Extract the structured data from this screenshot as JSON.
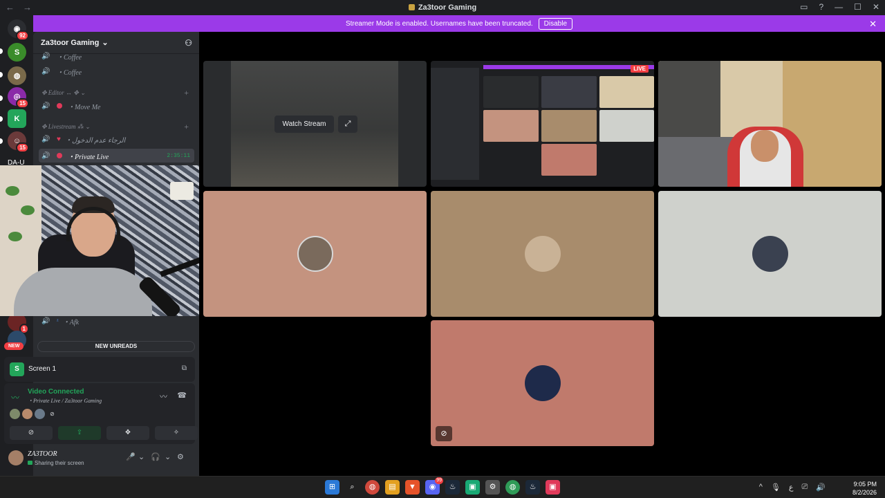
{
  "window": {
    "title": "Za3toor Gaming",
    "back": "←",
    "forward": "→",
    "controls": [
      "▭",
      "?",
      "—",
      "☐",
      "✕"
    ]
  },
  "rail": {
    "servers": [
      {
        "glyph": "◉",
        "color": "#2b2d31",
        "badge": "92"
      },
      {
        "glyph": "S",
        "color": "#3a8c2a",
        "badge": ""
      },
      {
        "glyph": "◍",
        "color": "#7a6a4a",
        "badge": ""
      },
      {
        "glyph": "◎",
        "color": "#8a2aa8",
        "badge": "15"
      },
      {
        "glyph": "K",
        "color": "#23a55a",
        "badge": ""
      },
      {
        "glyph": "☺",
        "color": "#6b3a3a",
        "badge": "15"
      }
    ],
    "label": "DA-U",
    "lower_badge": "1"
  },
  "banner": {
    "text": "Streamer Mode is enabled. Usernames have been truncated.",
    "button": "Disable",
    "close": "✕"
  },
  "guild": {
    "name": "Za3toor Gaming",
    "chevron": "⌄",
    "invite_icon": "person-add"
  },
  "channels": [
    {
      "name": "・Coffee",
      "kind": "voice",
      "cup": "☕"
    },
    {
      "name": "・Coffee",
      "kind": "voice",
      "cup": "☕"
    },
    {
      "name": "Editor",
      "kind": "category"
    },
    {
      "name": "・Move Me",
      "kind": "voice"
    },
    {
      "name": "Livestream",
      "kind": "category"
    },
    {
      "name": "・الرجاء عدم الدخول",
      "kind": "voice"
    },
    {
      "name": "・Private Live",
      "kind": "voice",
      "active": true,
      "time": "2:35:11"
    },
    {
      "name": "・Afk",
      "kind": "voice"
    }
  ],
  "categories": {
    "editor": "✥ Editor ↔ ✥ ⌄",
    "livestream": "✥ Livestream ⁂ ⌄",
    "plus": "+"
  },
  "unreads": {
    "new_label": "NEW",
    "text": "NEW UNREADS"
  },
  "screen_panel": {
    "icon_letter": "S",
    "name": "Screen 1",
    "popout_icon": "⧉"
  },
  "voice": {
    "status": "Video Connected",
    "location": "・Private Live / Za3toor Gaming",
    "noise_icon": "〰",
    "disconnect_icon": "☎",
    "signal_icon": "📶",
    "mini_avatars": [
      "",
      "",
      "",
      "⊘"
    ],
    "buttons": [
      {
        "icon": "⊘",
        "on": false
      },
      {
        "icon": "⇪",
        "on": true
      },
      {
        "icon": "❖",
        "on": false
      },
      {
        "icon": "✧",
        "on": false
      }
    ]
  },
  "user": {
    "name": "ZA3TOOR",
    "status": "Sharing their screen",
    "mic_icon": "🎤",
    "headset_icon": "🎧",
    "settings_icon": "⚙",
    "chev": "⌄"
  },
  "tiles": {
    "watch_stream": "Watch Stream",
    "live_badge": "LIVE",
    "mute_icon": "⊘"
  },
  "taskbar": {
    "apps": [
      {
        "glyph": "⊞",
        "color": "#2b79d6",
        "badge": ""
      },
      {
        "glyph": "⌕",
        "color": "transparent",
        "badge": ""
      },
      {
        "glyph": "◍",
        "color": "#d0493c",
        "badge": ""
      },
      {
        "glyph": "▤",
        "color": "#e3a020",
        "badge": ""
      },
      {
        "glyph": "▼",
        "color": "#e6532a",
        "badge": ""
      },
      {
        "glyph": "◉",
        "color": "#5865f2",
        "badge": "99"
      },
      {
        "glyph": "♨",
        "color": "#1b2838",
        "badge": ""
      },
      {
        "glyph": "▣",
        "color": "#19a974",
        "badge": ""
      },
      {
        "glyph": "⚙",
        "color": "#555",
        "badge": ""
      },
      {
        "glyph": "◍",
        "color": "#2f9b57",
        "badge": ""
      },
      {
        "glyph": "♨",
        "color": "#1b2838",
        "badge": ""
      },
      {
        "glyph": "▣",
        "color": "#e03a5a",
        "badge": ""
      }
    ],
    "tray": [
      "^",
      "🎙",
      "ع",
      "⎚",
      "🔊"
    ],
    "time": "9:05 PM",
    "date": "8/2/2026"
  },
  "colors": {
    "brand": "#5865f2",
    "streamer_banner": "#9b3ae8",
    "online_green": "#23a55a",
    "live_red": "#f23f43"
  }
}
